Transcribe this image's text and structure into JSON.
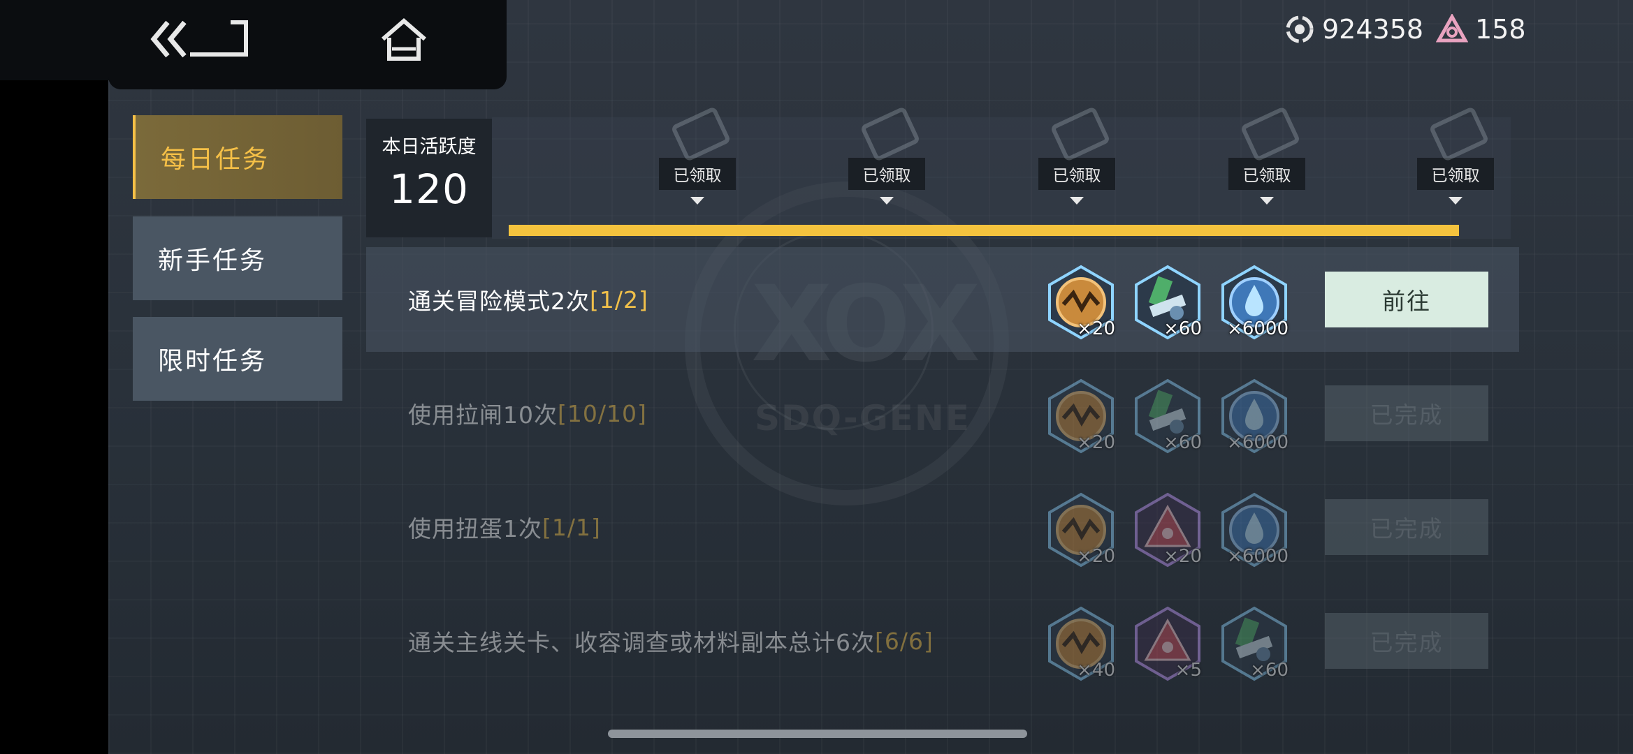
{
  "header": {
    "currency_a": {
      "icon": "eye-coin-icon",
      "value": "924358"
    },
    "currency_b": {
      "icon": "triangle-gem-icon",
      "value": "158"
    }
  },
  "sidebar": {
    "tabs": [
      {
        "label": "每日任务",
        "active": true
      },
      {
        "label": "新手任务",
        "active": false
      },
      {
        "label": "限时任务",
        "active": false
      }
    ]
  },
  "activity": {
    "label": "本日活跃度",
    "value": "120",
    "progress_fraction": 1.0,
    "milestones": [
      {
        "label": "已领取"
      },
      {
        "label": "已领取"
      },
      {
        "label": "已领取"
      },
      {
        "label": "已领取"
      },
      {
        "label": "已领取"
      }
    ]
  },
  "tasks": [
    {
      "title": "通关冒险模式2次",
      "progress": "[1/2]",
      "rewards": [
        {
          "icon": "bolt-medal-icon",
          "count": "×20"
        },
        {
          "icon": "mech-part-icon",
          "count": "×60"
        },
        {
          "icon": "water-drop-icon",
          "count": "×6000"
        }
      ],
      "button": "前往",
      "completed": false
    },
    {
      "title": "使用拉闸10次",
      "progress": "[10/10]",
      "rewards": [
        {
          "icon": "bolt-medal-icon",
          "count": "×20"
        },
        {
          "icon": "mech-part-icon",
          "count": "×60"
        },
        {
          "icon": "water-drop-icon",
          "count": "×6000"
        }
      ],
      "button": "已完成",
      "completed": true
    },
    {
      "title": "使用扭蛋1次",
      "progress": "[1/1]",
      "rewards": [
        {
          "icon": "bolt-medal-icon",
          "count": "×20"
        },
        {
          "icon": "red-crystal-icon",
          "count": "×20"
        },
        {
          "icon": "water-drop-icon",
          "count": "×6000"
        }
      ],
      "button": "已完成",
      "completed": true
    },
    {
      "title": "通关主线关卡、收容调查或材料副本总计6次",
      "progress": "[6/6]",
      "rewards": [
        {
          "icon": "bolt-medal-icon",
          "count": "×40"
        },
        {
          "icon": "red-crystal-icon",
          "count": "×5"
        },
        {
          "icon": "mech-part-icon",
          "count": "×60"
        }
      ],
      "button": "已完成",
      "completed": true
    }
  ],
  "background": {
    "logo_text": "SDQ-GENE"
  },
  "colors": {
    "accent": "#f4c33e",
    "go_button": "#d9ece1",
    "progress_text": "#f1c04a"
  }
}
